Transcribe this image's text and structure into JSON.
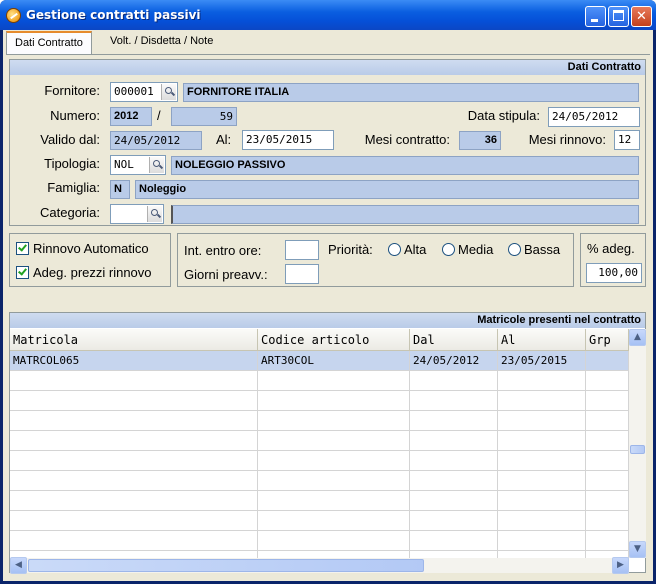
{
  "window": {
    "title": "Gestione contratti passivi",
    "minimize_glyph": "",
    "close_glyph": "✕"
  },
  "tabs": [
    {
      "label": "Dati Contratto"
    },
    {
      "label": "Volt. / Disdetta / Note"
    }
  ],
  "section_contract": {
    "heading": "Dati Contratto",
    "fornitore_label": "Fornitore:",
    "fornitore_code": "000001",
    "fornitore_name": "FORNITORE ITALIA",
    "numero_label": "Numero:",
    "numero_year": "2012",
    "numero_sep": "/",
    "numero_value": "59",
    "data_stipula_label": "Data stipula:",
    "data_stipula": "24/05/2012",
    "valido_dal_label": "Valido dal:",
    "valido_dal": "24/05/2012",
    "al_label": "Al:",
    "al": "23/05/2015",
    "mesi_contratto_label": "Mesi contratto:",
    "mesi_contratto": "36",
    "mesi_rinnovo_label": "Mesi rinnovo:",
    "mesi_rinnovo": "12",
    "tipologia_label": "Tipologia:",
    "tipologia_code": "NOL",
    "tipologia_desc": "NOLEGGIO PASSIVO",
    "famiglia_label": "Famiglia:",
    "famiglia_code": "N",
    "famiglia_desc": "Noleggio",
    "categoria_label": "Categoria:",
    "categoria_code": "",
    "categoria_desc": ""
  },
  "options": {
    "rinnovo_automatico_label": "Rinnovo Automatico",
    "rinnovo_automatico_checked": true,
    "adeg_prezzi_label": "Adeg. prezzi rinnovo",
    "adeg_prezzi_checked": true,
    "int_entro_ore_label": "Int. entro ore:",
    "int_entro_ore": "",
    "giorni_preavv_label": "Giorni preavv.:",
    "giorni_preavv": "",
    "priorita_label": "Priorità:",
    "priorita_options": [
      "Alta",
      "Media",
      "Bassa"
    ],
    "perc_adeg_label": "% adeg.",
    "perc_adeg": "100,00"
  },
  "matricole": {
    "heading": "Matricole presenti nel contratto",
    "columns": [
      "Matricola",
      "Codice articolo",
      "Dal",
      "Al",
      "Grp"
    ],
    "rows": [
      [
        "MATRCOL065",
        "ART30COL",
        "24/05/2012",
        "23/05/2015",
        ""
      ]
    ],
    "empty_rows": 10
  }
}
